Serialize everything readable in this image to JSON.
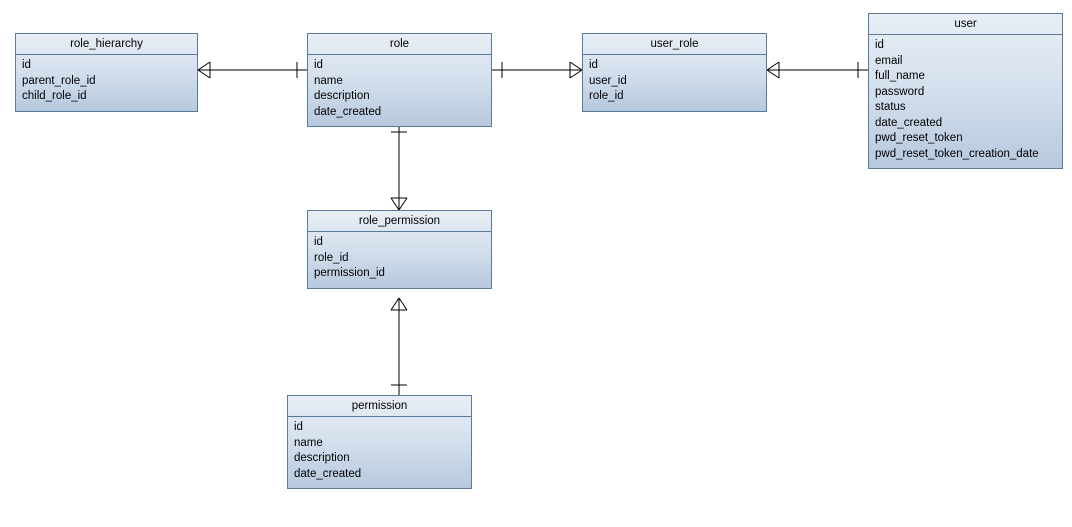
{
  "diagram_type": "entity-relationship",
  "entities": {
    "role_hierarchy": {
      "title": "role_hierarchy",
      "attrs": [
        "id",
        "parent_role_id",
        "child_role_id"
      ]
    },
    "role": {
      "title": "role",
      "attrs": [
        "id",
        "name",
        "description",
        "date_created"
      ]
    },
    "user_role": {
      "title": "user_role",
      "attrs": [
        "id",
        "user_id",
        "role_id"
      ]
    },
    "user": {
      "title": "user",
      "attrs": [
        "id",
        "email",
        "full_name",
        "password",
        "status",
        "date_created",
        "pwd_reset_token",
        "pwd_reset_token_creation_date"
      ]
    },
    "role_permission": {
      "title": "role_permission",
      "attrs": [
        "id",
        "role_id",
        "permission_id"
      ]
    },
    "permission": {
      "title": "permission",
      "attrs": [
        "id",
        "name",
        "description",
        "date_created"
      ]
    }
  },
  "relationships": [
    {
      "from": "role",
      "from_card": "one",
      "to": "role_hierarchy",
      "to_card": "many"
    },
    {
      "from": "role",
      "from_card": "one",
      "to": "user_role",
      "to_card": "many"
    },
    {
      "from": "user",
      "from_card": "one",
      "to": "user_role",
      "to_card": "many"
    },
    {
      "from": "role",
      "from_card": "one",
      "to": "role_permission",
      "to_card": "many"
    },
    {
      "from": "permission",
      "from_card": "one",
      "to": "role_permission",
      "to_card": "many"
    }
  ]
}
